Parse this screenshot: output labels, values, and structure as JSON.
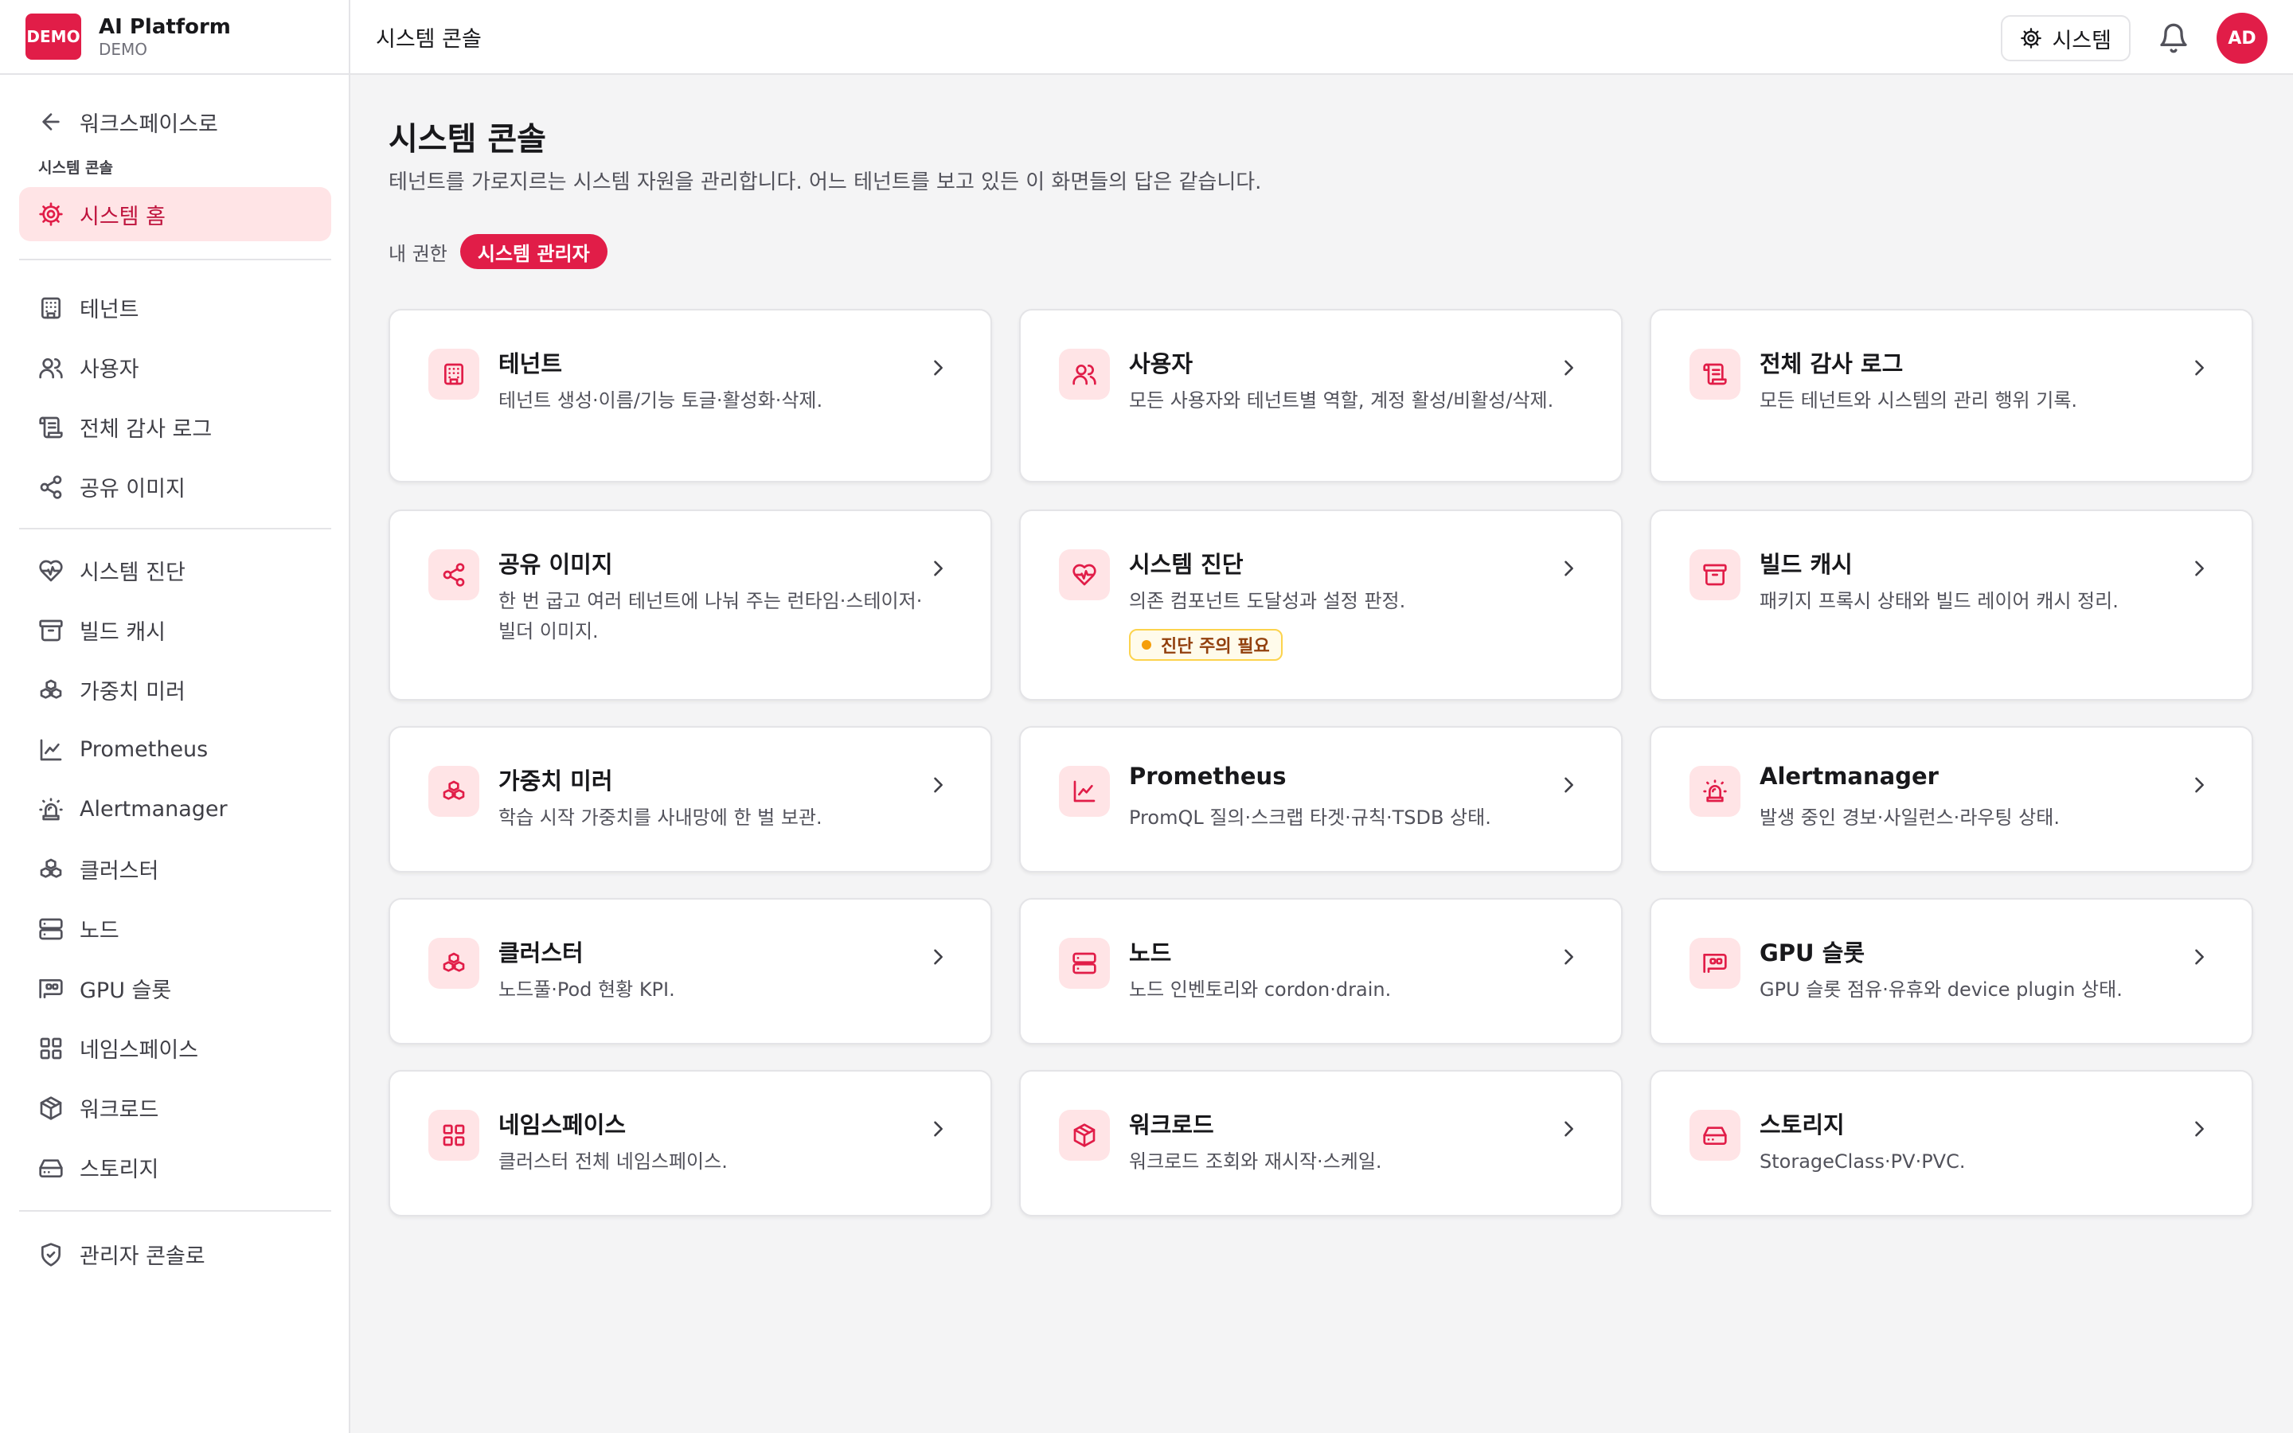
{
  "brand": {
    "logo": "DEMO",
    "name": "AI Platform",
    "sub": "DEMO"
  },
  "topbar": {
    "title": "시스템 콘솔",
    "system_button": "시스템",
    "avatar": "AD"
  },
  "sidebar": {
    "back": "워크스페이스로",
    "section": "시스템 콘솔",
    "home": "시스템 홈",
    "group1": [
      "테넌트",
      "사용자",
      "전체 감사 로그",
      "공유 이미지"
    ],
    "group2": [
      "시스템 진단",
      "빌드 캐시",
      "가중치 미러",
      "Prometheus",
      "Alertmanager",
      "클러스터",
      "노드",
      "GPU 슬롯",
      "네임스페이스",
      "워크로드",
      "스토리지"
    ],
    "admin": "관리자 콘솔로"
  },
  "page": {
    "title": "시스템 콘솔",
    "description": "테넌트를 가로지르는 시스템 자원을 관리합니다. 어느 테넌트를 보고 있든 이 화면들의 답은 같습니다.",
    "perm_label": "내 권한",
    "perm_badge": "시스템 관리자"
  },
  "cards": [
    {
      "title": "테넌트",
      "desc": "테넌트 생성·이름/기능 토글·활성화·삭제.",
      "icon": "building-icon"
    },
    {
      "title": "사용자",
      "desc": "모든 사용자와 테넌트별 역할, 계정 활성/비활성/삭제.",
      "icon": "users-icon"
    },
    {
      "title": "전체 감사 로그",
      "desc": "모든 테넌트와 시스템의 관리 행위 기록.",
      "icon": "scroll-icon"
    },
    {
      "title": "공유 이미지",
      "desc": "한 번 굽고 여러 테넌트에 나눠 주는 런타임·스테이저·빌더 이미지.",
      "icon": "share-icon"
    },
    {
      "title": "시스템 진단",
      "desc": "의존 컴포넌트 도달성과 설정 판정.",
      "icon": "heart-pulse-icon",
      "badge": "진단 주의 필요"
    },
    {
      "title": "빌드 캐시",
      "desc": "패키지 프록시 상태와 빌드 레이어 캐시 정리.",
      "icon": "archive-icon"
    },
    {
      "title": "가중치 미러",
      "desc": "학습 시작 가중치를 사내망에 한 벌 보관.",
      "icon": "boxes-icon"
    },
    {
      "title": "Prometheus",
      "desc": "PromQL 질의·스크랩 타겟·규칙·TSDB 상태.",
      "icon": "chart-line-icon"
    },
    {
      "title": "Alertmanager",
      "desc": "발생 중인 경보·사일런스·라우팅 상태.",
      "icon": "siren-icon"
    },
    {
      "title": "클러스터",
      "desc": "노드풀·Pod 현황 KPI.",
      "icon": "boxes-icon"
    },
    {
      "title": "노드",
      "desc": "노드 인벤토리와 cordon·drain.",
      "icon": "server-icon"
    },
    {
      "title": "GPU 슬롯",
      "desc": "GPU 슬롯 점유·유휴와 device plugin 상태.",
      "icon": "gpu-icon"
    },
    {
      "title": "네임스페이스",
      "desc": "클러스터 전체 네임스페이스.",
      "icon": "grid-icon"
    },
    {
      "title": "워크로드",
      "desc": "워크로드 조회와 재시작·스케일.",
      "icon": "package-icon"
    },
    {
      "title": "스토리지",
      "desc": "StorageClass·PV·PVC.",
      "icon": "hard-drive-icon"
    }
  ],
  "colors": {
    "accent": "#e11d48",
    "accent_soft": "#ffe4e6",
    "warning": "#f59e0b"
  }
}
